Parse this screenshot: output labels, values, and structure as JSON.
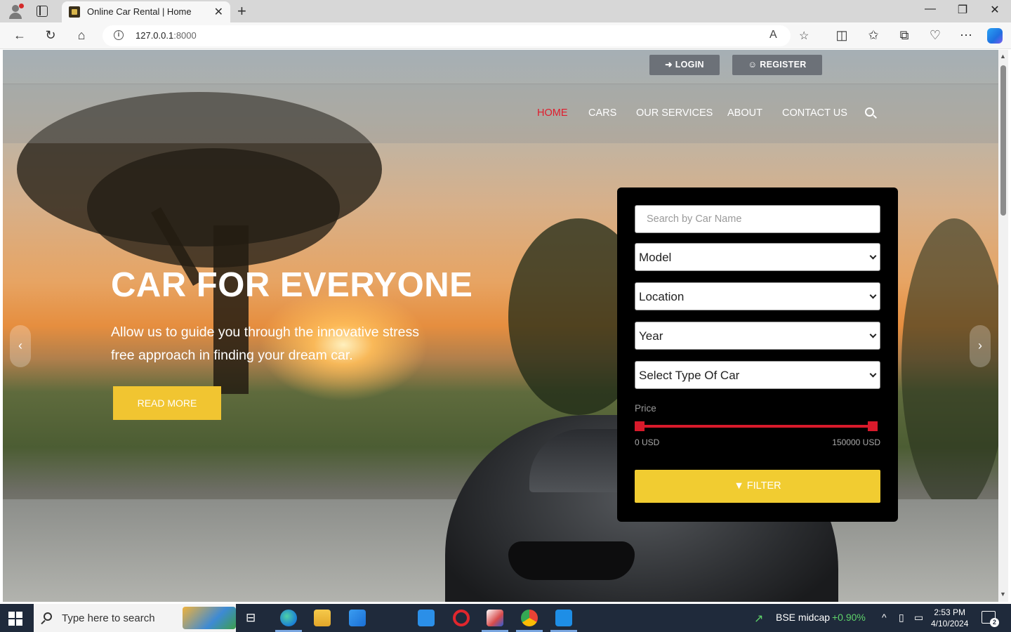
{
  "browser": {
    "tab_title": "Online Car Rental | Home",
    "url_host": "127.0.0.1",
    "url_port": ":8000",
    "icons": [
      "profile-icon",
      "tab-actions-icon",
      "close-tab-icon",
      "new-tab-icon",
      "minimize-icon",
      "restore-icon",
      "close-window-icon",
      "back-icon",
      "refresh-icon",
      "home-icon",
      "info-icon",
      "read-aloud-icon",
      "favorite-icon",
      "split-screen-icon",
      "favorites-icon",
      "collections-icon",
      "browser-essentials-icon",
      "more-icon",
      "copilot-icon"
    ]
  },
  "topbar": {
    "login_label": "LOGIN",
    "register_label": "REGISTER"
  },
  "nav": {
    "items": [
      {
        "label": "HOME",
        "active": true
      },
      {
        "label": "CARS",
        "active": false
      },
      {
        "label": "OUR SERVICES",
        "active": false
      },
      {
        "label": "ABOUT",
        "active": false
      },
      {
        "label": "CONTACT US",
        "active": false
      }
    ],
    "active_color": "#e01b2c"
  },
  "hero": {
    "title": "CAR FOR EVERYONE",
    "text": "Allow us to guide you through the innovative stress free approach in finding your dream car.",
    "button_label": "READ MORE",
    "accent_color": "#f1c531"
  },
  "filter": {
    "search_placeholder": "Search by Car Name",
    "model": "Model",
    "location": "Location",
    "year": "Year",
    "car_type": "Select Type Of Car",
    "price_label": "Price",
    "price_min": "0 USD",
    "price_max": "150000 USD",
    "price_range_fraction": [
      0,
      1
    ],
    "button_label": "FILTER",
    "slider_color": "#d81a2b"
  },
  "taskbar": {
    "search_text": "Type here to search",
    "stock_name": "BSE midcap",
    "stock_change": "+0.90%",
    "time": "2:53 PM",
    "date": "4/10/2024",
    "notification_count": "2"
  }
}
